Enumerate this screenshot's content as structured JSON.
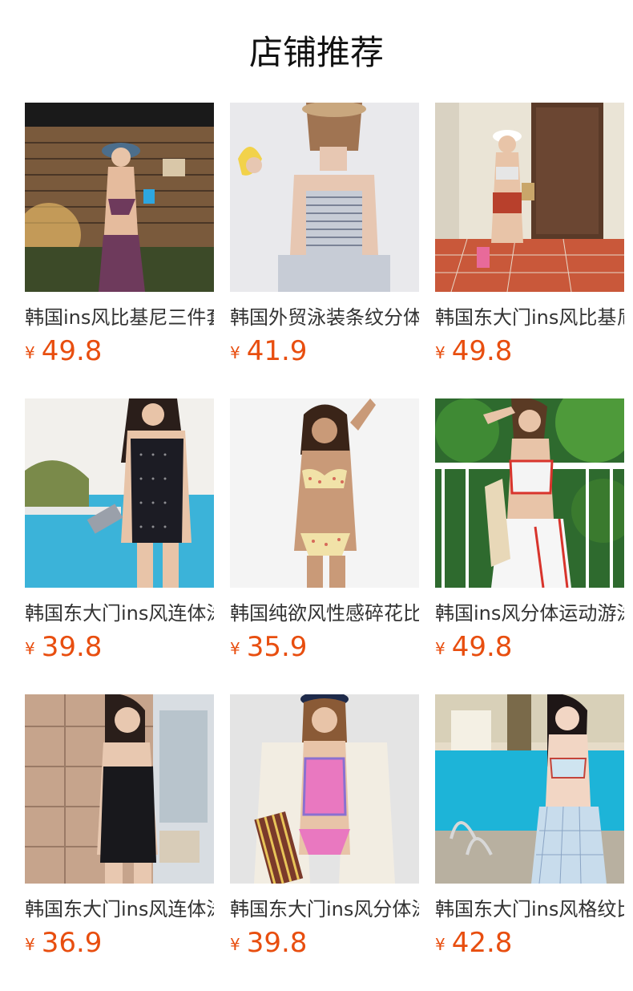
{
  "header": {
    "title": "店铺推荐"
  },
  "products": [
    {
      "name": "韩国ins风比基尼三件套",
      "currency": "¥",
      "price": "49.8",
      "image": "bikini-poolside-night"
    },
    {
      "name": "韩国外贸泳装条纹分体",
      "currency": "¥",
      "price": "41.9",
      "image": "striped-halter-swimsuit"
    },
    {
      "name": "韩国东大门ins风比基尼",
      "currency": "¥",
      "price": "49.8",
      "image": "bandeau-high-waist-bikini"
    },
    {
      "name": "韩国东大门ins风连体泳衣",
      "currency": "¥",
      "price": "39.8",
      "image": "polka-dot-halter-onepiece"
    },
    {
      "name": "韩国纯欲风性感碎花比基尼",
      "currency": "¥",
      "price": "35.9",
      "image": "floral-ruffle-bikini"
    },
    {
      "name": "韩国ins风分体运动游泳衣",
      "currency": "¥",
      "price": "49.8",
      "image": "sporty-two-piece-skirt"
    },
    {
      "name": "韩国东大门ins风连体泳衣",
      "currency": "¥",
      "price": "36.9",
      "image": "black-onepiece-balcony"
    },
    {
      "name": "韩国东大门ins风分体泳衣",
      "currency": "¥",
      "price": "39.8",
      "image": "pink-two-piece-cardigan"
    },
    {
      "name": "韩国东大门ins风格纹比基尼",
      "currency": "¥",
      "price": "42.8",
      "image": "plaid-bikini-sarong-pool"
    }
  ],
  "colors": {
    "price": "#e84e0f",
    "title": "#111111",
    "name": "#333333"
  }
}
